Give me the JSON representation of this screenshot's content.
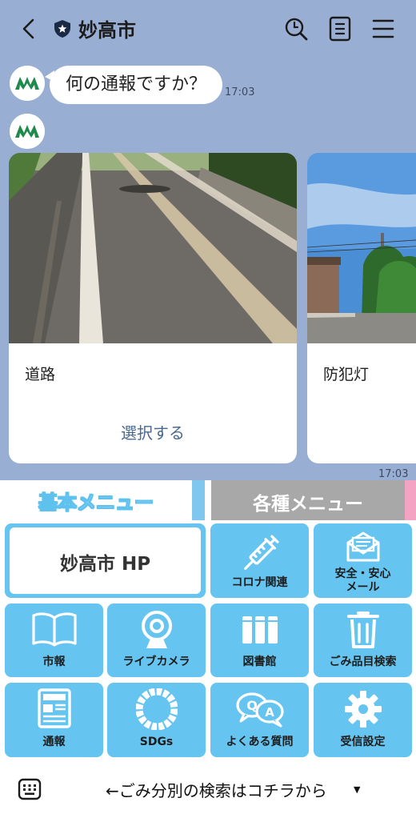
{
  "header": {
    "title": "妙高市"
  },
  "messages": {
    "question": "何の通報ですか？",
    "question_time": "17:03",
    "carousel_time": "17:03"
  },
  "carousel": [
    {
      "label": "道路",
      "action": "選択する"
    },
    {
      "label": "防犯灯",
      "action": ""
    }
  ],
  "rich_menu": {
    "tabs": {
      "basic": "基本メニュー",
      "various": "各種メニュー"
    },
    "homepage": "妙高市 HP",
    "tiles": [
      {
        "label": "コロナ関連",
        "icon": "syringe-icon"
      },
      {
        "label": "安全・安心\nメール",
        "icon": "mail-icon"
      },
      {
        "label": "市報",
        "icon": "book-icon"
      },
      {
        "label": "ライブカメラ",
        "icon": "webcam-icon"
      },
      {
        "label": "図書館",
        "icon": "library-books-icon"
      },
      {
        "label": "ごみ品目検索",
        "icon": "trash-icon"
      },
      {
        "label": "通報",
        "icon": "newspaper-icon"
      },
      {
        "label": "SDGs",
        "icon": "sdgs-wheel-icon"
      },
      {
        "label": "よくある質問",
        "icon": "qa-bubbles-icon"
      },
      {
        "label": "受信設定",
        "icon": "gear-icon"
      }
    ]
  },
  "footer": {
    "text": "←ごみ分別の検索はコチラから"
  },
  "colors": {
    "chat_bg": "#99aed3",
    "tile": "#66c4f0",
    "accent_text": "#49688f",
    "logo_green": "#1f8a4c"
  }
}
